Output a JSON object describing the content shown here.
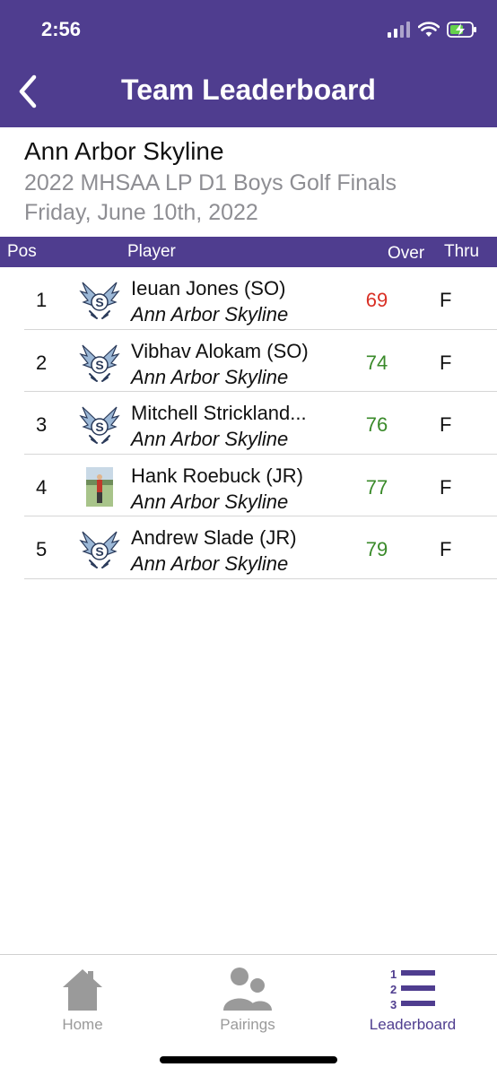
{
  "status_bar": {
    "time": "2:56"
  },
  "nav": {
    "title": "Team Leaderboard"
  },
  "team": {
    "name": "Ann Arbor Skyline",
    "event": "2022 MHSAA LP D1 Boys Golf Finals",
    "date": "Friday, June 10th, 2022"
  },
  "table": {
    "headers": {
      "pos": "Pos",
      "player": "Player",
      "over": "Over",
      "thru": "Thru"
    },
    "rows": [
      {
        "pos": "1",
        "name": "Ieuan Jones (SO)",
        "team": "Ann Arbor Skyline",
        "over": "69",
        "over_color": "#d93025",
        "thru": "F",
        "avatar": "skyline-eagle-logo"
      },
      {
        "pos": "2",
        "name": "Vibhav Alokam (SO)",
        "team": "Ann Arbor Skyline",
        "over": "74",
        "over_color": "#3a8a2a",
        "thru": "F",
        "avatar": "skyline-eagle-logo"
      },
      {
        "pos": "3",
        "name": "Mitchell Strickland...",
        "team": "Ann Arbor Skyline",
        "over": "76",
        "over_color": "#3a8a2a",
        "thru": "F",
        "avatar": "skyline-eagle-logo"
      },
      {
        "pos": "4",
        "name": "Hank Roebuck (JR)",
        "team": "Ann Arbor Skyline",
        "over": "77",
        "over_color": "#3a8a2a",
        "thru": "F",
        "avatar": "player-photo"
      },
      {
        "pos": "5",
        "name": "Andrew Slade (JR)",
        "team": "Ann Arbor Skyline",
        "over": "79",
        "over_color": "#3a8a2a",
        "thru": "F",
        "avatar": "skyline-eagle-logo"
      }
    ]
  },
  "tabs": [
    {
      "label": "Home",
      "icon": "home-icon",
      "active": false
    },
    {
      "label": "Pairings",
      "icon": "people-icon",
      "active": false
    },
    {
      "label": "Leaderboard",
      "icon": "leaderboard-list-icon",
      "active": true
    }
  ],
  "colors": {
    "brand": "#4f3d8f",
    "inactive_tab": "#9a9a9a",
    "over_red": "#d93025",
    "over_green": "#3a8a2a"
  }
}
